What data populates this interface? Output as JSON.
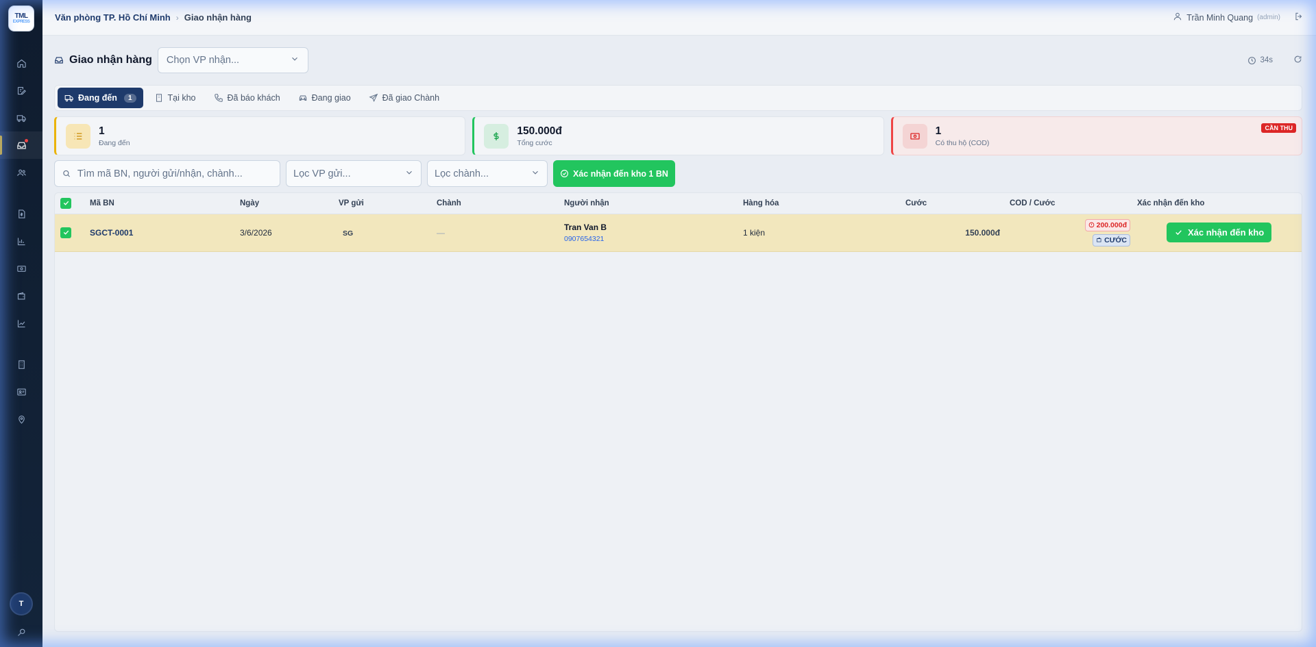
{
  "app": {
    "logo_text": "TML",
    "logo_sub": "EXPRESS"
  },
  "sidebar": {
    "items": [
      {
        "icon": "home-icon"
      },
      {
        "icon": "edit-note-icon"
      },
      {
        "icon": "truck-icon"
      },
      {
        "icon": "inbox-icon",
        "active": true
      },
      {
        "icon": "users-icon"
      },
      {
        "icon": "file-dollar-icon"
      },
      {
        "icon": "bar-chart-icon"
      },
      {
        "icon": "cash-icon"
      },
      {
        "icon": "wallet-icon"
      },
      {
        "icon": "trend-chart-icon"
      },
      {
        "icon": "building-icon"
      },
      {
        "icon": "id-card-icon"
      },
      {
        "icon": "map-pin-icon"
      }
    ],
    "avatar_initial": "T"
  },
  "topbar": {
    "breadcrumb": [
      "Văn phòng TP. Hồ Chí Minh",
      "Giao nhận hàng"
    ],
    "user_name": "Trần Minh Quang",
    "user_role": "(admin)"
  },
  "page": {
    "title": "Giao nhận hàng",
    "vp_select_placeholder": "Chọn VP nhận...",
    "timer": "34s"
  },
  "tabs": [
    {
      "label": "Đang đến",
      "count": "1",
      "active": true
    },
    {
      "label": "Tại kho"
    },
    {
      "label": "Đã báo khách"
    },
    {
      "label": "Đang giao"
    },
    {
      "label": "Đã giao Chành"
    }
  ],
  "stats": [
    {
      "value": "1",
      "label": "Đang đến",
      "color": "#eab308"
    },
    {
      "value": "150.000đ",
      "label": "Tổng cước",
      "color": "#22c55e"
    },
    {
      "value": "1",
      "label": "Có thu hộ (COD)",
      "badge": "CẦN THU",
      "color": "#ef4444"
    }
  ],
  "filters": {
    "search_placeholder": "Tìm mã BN, người gửi/nhận, chành...",
    "vp_filter": "Lọc VP gửi...",
    "chanh_filter": "Lọc chành...",
    "confirm_all": "Xác nhận đến kho 1 BN"
  },
  "table": {
    "columns": [
      "Mã BN",
      "Ngày",
      "VP gửi",
      "Chành",
      "Người nhận",
      "Hàng hóa",
      "Cước",
      "COD / Cước",
      "Xác nhận đến kho"
    ],
    "rows": [
      {
        "code": "SGCT-0001",
        "date": "3/6/2026",
        "vp": "SG",
        "chanh": "—",
        "receiver_name": "Tran Van B",
        "receiver_phone": "0907654321",
        "goods": "1 kiện",
        "fee": "150.000đ",
        "cod": "200.000đ",
        "fee_tag": "CƯỚC",
        "action": "Xác nhận đến kho"
      }
    ]
  },
  "colors": {
    "primary": "#1e3a6b",
    "success": "#22c55e",
    "danger": "#dc2626",
    "row_highlight": "#f2e7bd"
  }
}
